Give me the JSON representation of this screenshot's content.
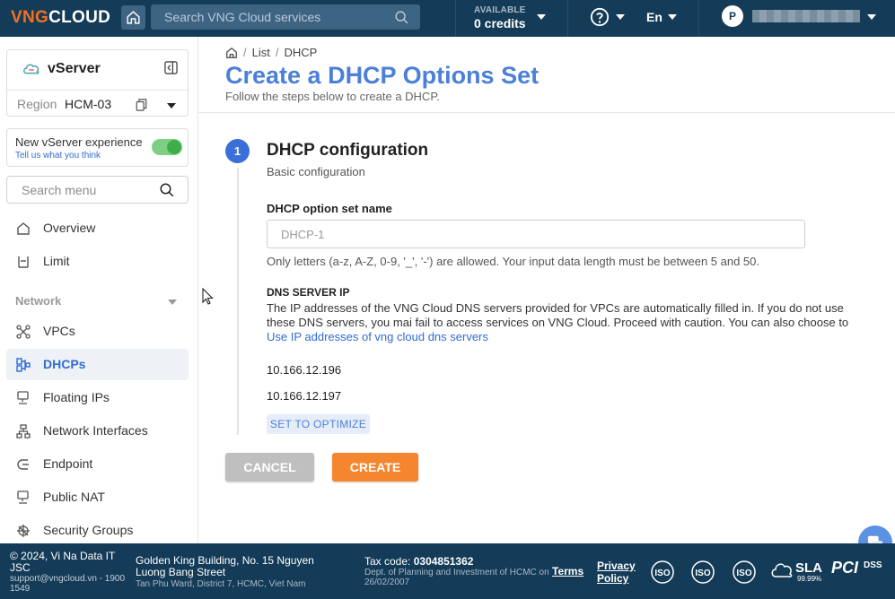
{
  "topbar": {
    "logo_a": "VNG",
    "logo_b": "CLOUD",
    "search_placeholder": "Search VNG Cloud services",
    "credits_label": "AVAILABLE",
    "credits_value": "0 credits",
    "lang": "En",
    "user_initial": "P"
  },
  "sidebar": {
    "service_name": "vServer",
    "region_label": "Region",
    "region_value": "HCM-03",
    "experience_title": "New vServer experience",
    "experience_link": "Tell us what you think",
    "experience_enabled": true,
    "search_placeholder": "Search menu",
    "items": [
      {
        "label": "Overview",
        "icon": "home-icon"
      },
      {
        "label": "Limit",
        "icon": "limit-icon"
      }
    ],
    "section_network": "Network",
    "network_items": [
      {
        "label": "VPCs",
        "icon": "vpc-icon"
      },
      {
        "label": "DHCPs",
        "icon": "dhcp-icon",
        "active": true
      },
      {
        "label": "Floating IPs",
        "icon": "floating-ip-icon"
      },
      {
        "label": "Network Interfaces",
        "icon": "network-interface-icon"
      },
      {
        "label": "Endpoint",
        "icon": "endpoint-icon"
      },
      {
        "label": "Public NAT",
        "icon": "public-nat-icon"
      },
      {
        "label": "Security Groups",
        "icon": "security-groups-icon"
      }
    ]
  },
  "main": {
    "breadcrumb": [
      "List",
      "DHCP"
    ],
    "title": "Create a DHCP Options Set",
    "subtitle": "Follow the steps below to create a DHCP.",
    "step_number": "1",
    "step_title": "DHCP configuration",
    "step_subtitle": "Basic configuration",
    "name_label": "DHCP option set name",
    "name_value": "",
    "name_placeholder": "DHCP-1",
    "name_help": "Only letters (a-z, A-Z, 0-9, '_', '-') are allowed. Your input data length must be between 5 and 50.",
    "dns_title": "DNS SERVER IP",
    "dns_desc": "The IP addresses of the VNG Cloud DNS servers provided for VPCs are automatically filled in. If you do not use these DNS servers, you mai fail to access services on VNG Cloud. Proceed with caution. You can also choose to",
    "dns_link": "Use IP addresses of vng cloud dns servers",
    "dns_ips": [
      "10.166.12.196",
      "10.166.12.197"
    ],
    "optimize_label": "SET TO OPTIMIZE",
    "cancel_label": "CANCEL",
    "create_label": "CREATE"
  },
  "footer": {
    "copyright": "© 2024, Vi Na Data IT JSC",
    "contact": "support@vngcloud.vn - 1900 1549",
    "address": "Golden King Building, No. 15 Nguyen Luong Bang Street",
    "address2": "Tan Phu Ward, District 7, HCMC, Viet Nam",
    "tax_label": "Tax code:",
    "tax_code": "0304851362",
    "dept": "Dept. of Planning and Investment of HCMC on 26/02/2007",
    "terms": "Terms",
    "privacy": "Privacy Policy",
    "iso_label": "ISO",
    "sla_label": "SLA",
    "sla_value": "99.99%",
    "pci_label": "PCI",
    "dss_label": "DSS"
  },
  "colors": {
    "topbar_bg": "#143b57",
    "brand_orange": "#f37021",
    "accent_blue": "#4b7fd9",
    "create_btn": "#f5862e",
    "cancel_btn": "#bfbfbf",
    "toggle_on": "#3eae4b"
  }
}
